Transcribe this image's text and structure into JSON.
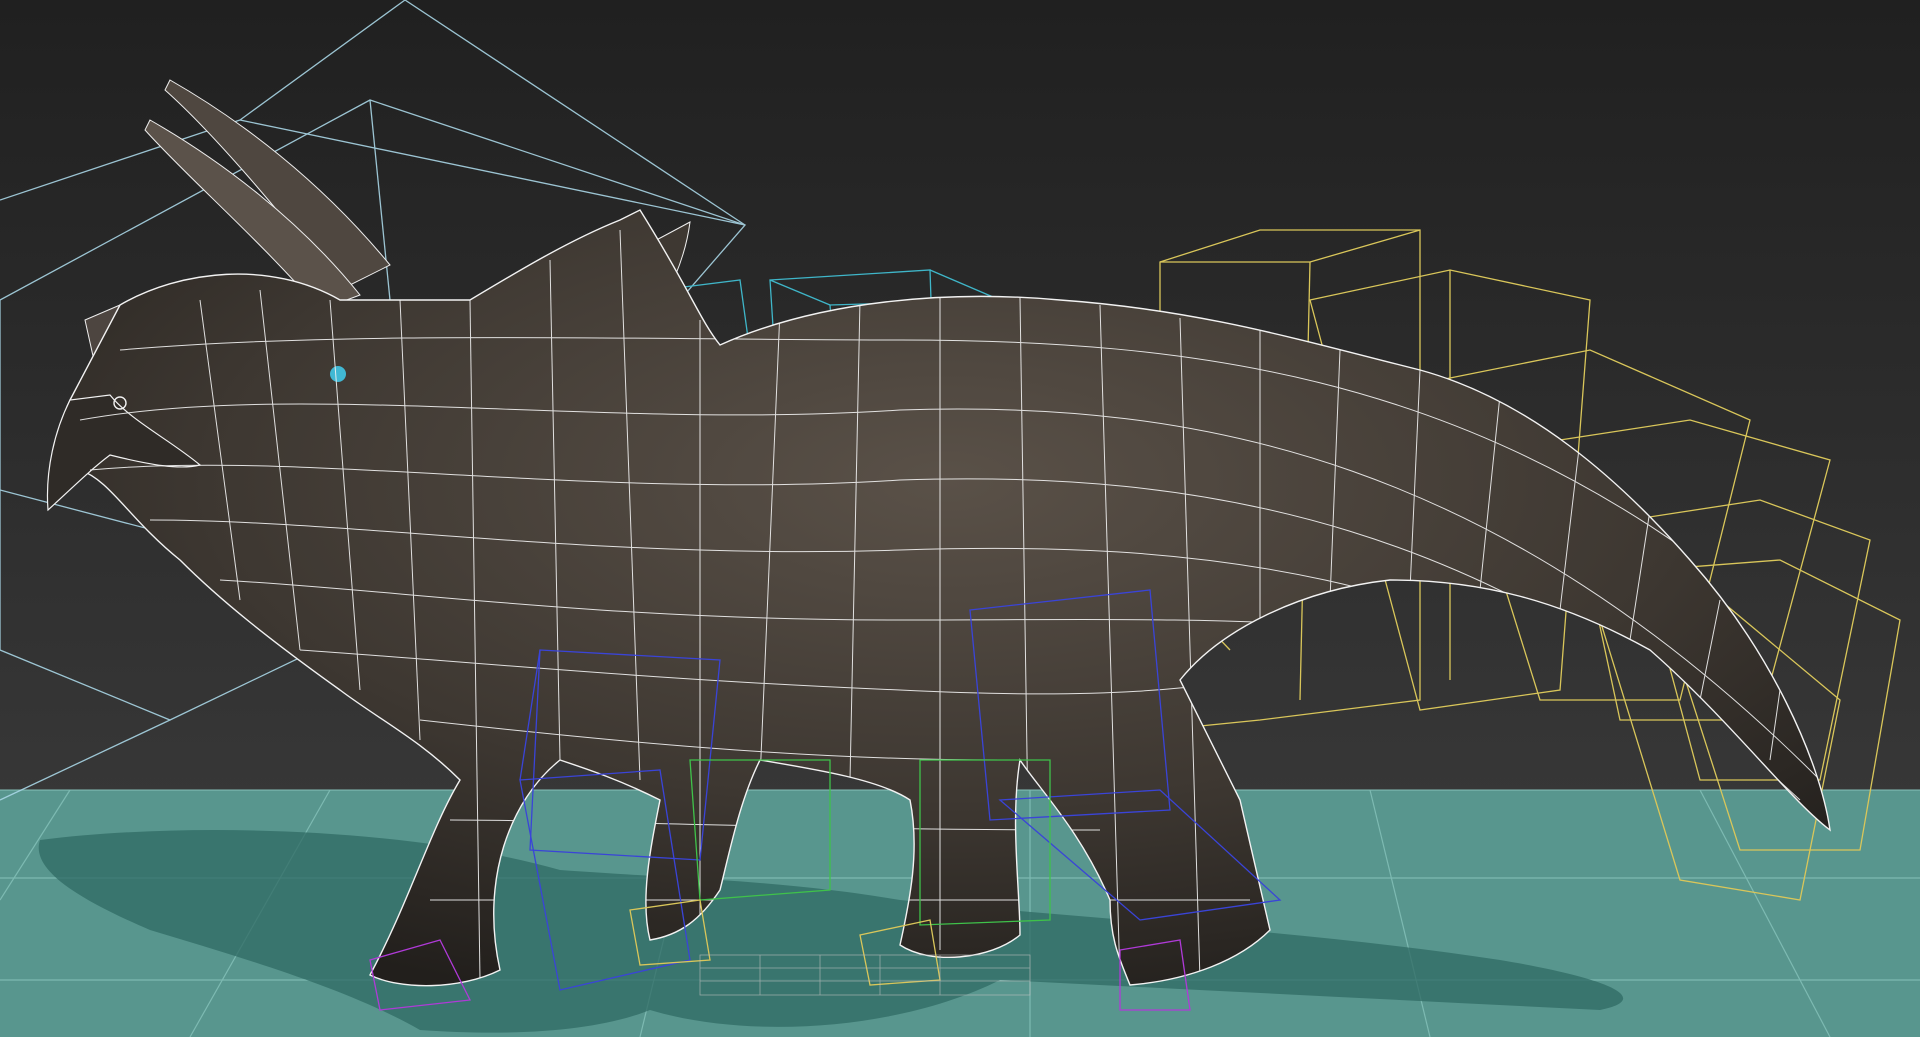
{
  "viewport": {
    "mode": "perspective",
    "shading": "smooth-shaded-with-wireframe"
  },
  "scene": {
    "subject": "triceratops",
    "colors": {
      "background_top": "#222222",
      "background_bottom": "#3c3c3c",
      "ground": "#58968e",
      "ground_shadow": "#2f6a63",
      "mesh_skin": "#3f3a35",
      "wireframe": "#f2f2f2",
      "bone_neck": "#3fb6c9",
      "bone_tail": "#d9c65a",
      "bone_leg_blue": "#3a44d8",
      "bone_leg_green": "#3fc24a",
      "bone_foot_purple": "#b03ad8",
      "bone_head": "#a9d6e6",
      "selected_vertex": "#41c7e6"
    },
    "bone_groups": [
      "head-bone",
      "neck-bones",
      "tail-bones",
      "front-leg-bones",
      "rear-leg-bones",
      "foot-bones"
    ]
  }
}
